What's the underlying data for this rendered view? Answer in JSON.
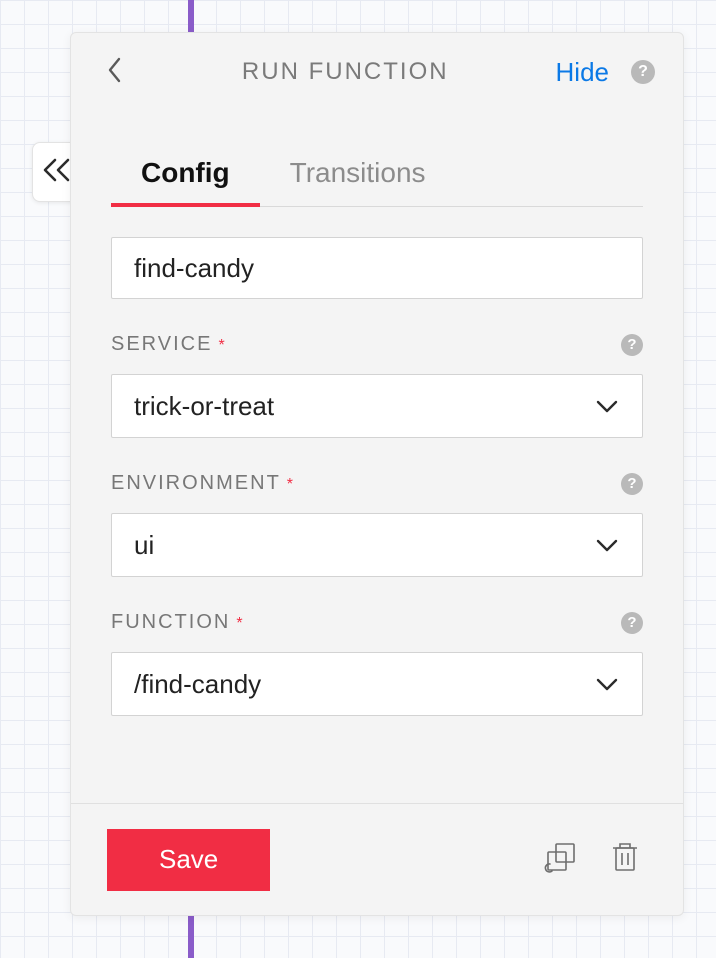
{
  "header": {
    "title": "RUN FUNCTION",
    "hide_label": "Hide"
  },
  "tabs": {
    "config": "Config",
    "transitions": "Transitions",
    "active": "config"
  },
  "form": {
    "name_value": "find-candy",
    "service": {
      "label": "SERVICE",
      "value": "trick-or-treat"
    },
    "environment": {
      "label": "ENVIRONMENT",
      "value": "ui"
    },
    "function": {
      "label": "FUNCTION",
      "value": "/find-candy"
    }
  },
  "footer": {
    "save_label": "Save"
  },
  "icons": {
    "back": "chevron-left",
    "collapse": "double-chevron-left",
    "help": "?",
    "chevron_down": "chevron-down",
    "duplicate": "duplicate",
    "trash": "trash"
  }
}
